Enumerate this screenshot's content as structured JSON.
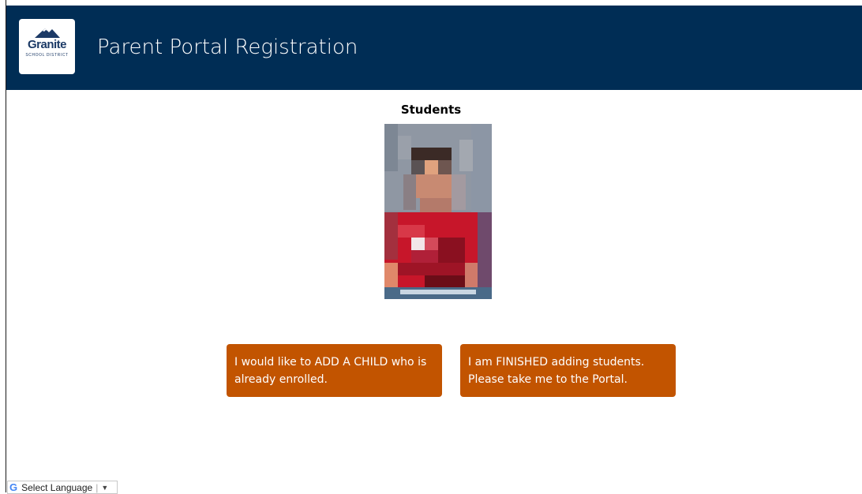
{
  "header": {
    "title": "Parent Portal Registration",
    "logo": {
      "word": "Granite",
      "sub": "SCHOOL DISTRICT"
    },
    "background": "#002d55"
  },
  "main": {
    "heading": "Students",
    "student_photo": "student-photo"
  },
  "actions": {
    "add_child_label": "I would like to ADD A CHILD who is already enrolled.",
    "finish_label": "I am FINISHED adding students. Please take me to the Portal.",
    "button_color": "#c25400"
  },
  "language": {
    "label": "Select Language"
  }
}
